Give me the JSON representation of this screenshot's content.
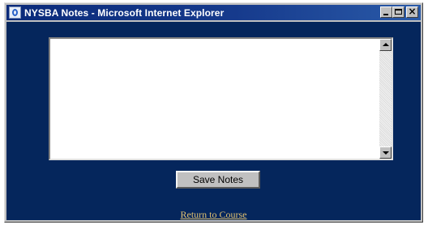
{
  "window": {
    "title": "NYSBA Notes - Microsoft Internet Explorer",
    "controls": {
      "minimize_icon": "minimize-icon",
      "maximize_icon": "maximize-icon",
      "close_icon": "close-icon",
      "close_glyph": "×"
    }
  },
  "notes": {
    "value": "",
    "placeholder": ""
  },
  "actions": {
    "save_label": "Save Notes",
    "return_label": "Return to Course"
  },
  "colors": {
    "background": "#05265c",
    "link": "#e0c070",
    "titlebar": "#0a2a7a"
  }
}
